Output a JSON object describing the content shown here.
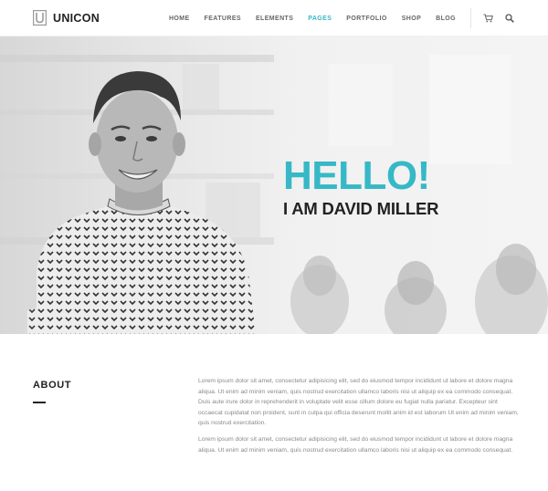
{
  "brand": {
    "name": "UNICON",
    "logo_letter": "U"
  },
  "nav": {
    "items": [
      {
        "label": "HOME",
        "active": false
      },
      {
        "label": "FEATURES",
        "active": false
      },
      {
        "label": "ELEMENTS",
        "active": false
      },
      {
        "label": "PAGES",
        "active": true
      },
      {
        "label": "PORTFOLIO",
        "active": false
      },
      {
        "label": "SHOP",
        "active": false
      },
      {
        "label": "BLOG",
        "active": false
      }
    ],
    "icons": [
      "cart-icon",
      "search-icon"
    ]
  },
  "hero": {
    "headline": "HELLO!",
    "subheadline": "I AM DAVID MILLER"
  },
  "about": {
    "title": "ABOUT",
    "paragraphs": [
      "Lorem ipsum dolor sit amet, consectetur adipisicing elit, sed do eiusmod tempor incididunt ut labore et dolore magna aliqua. Ut enim ad minim veniam, quis nostrud exercitation ullamco laboris nisi ut aliquip ex ea commodo consequat. Duis aute irure dolor in reprehenderit in voluptate velit esse cillum dolore eu fugiat nulla pariatur. Excepteur sint occaecat cupidatat non proident, sunt in culpa qui officia deserunt mollit anim id est laborum Ut enim ad minim veniam, quis nostrud exercitation.",
      "Lorem ipsum dolor sit amet, consectetur adipisicing elit, sed do eiusmod tempor incididunt ut labore et dolore magna aliqua. Ut enim ad minim veniam, quis nostrud exercitation ullamco laboris nisi ut aliquip ex ea commodo consequat."
    ]
  },
  "colors": {
    "accent": "#36b8c6",
    "text_dark": "#222222",
    "text_muted": "#8a8a8a"
  }
}
